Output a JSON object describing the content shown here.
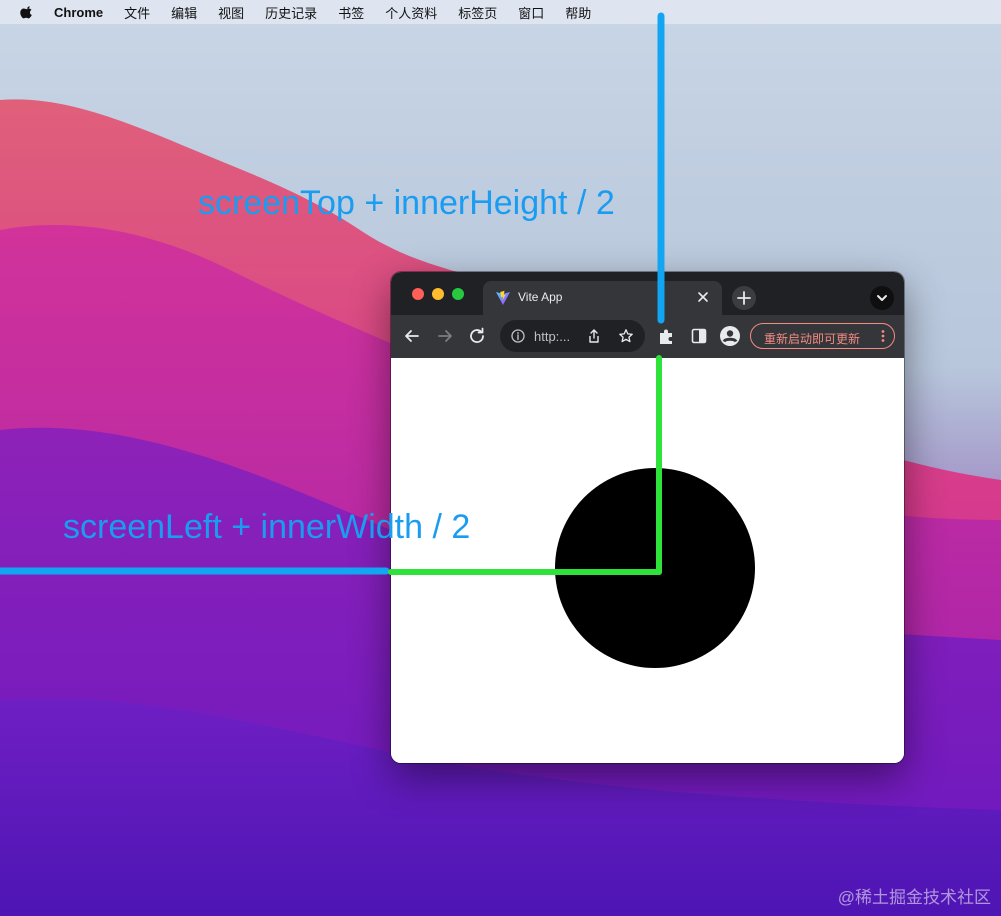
{
  "menubar": {
    "app_name": "Chrome",
    "items": [
      "文件",
      "编辑",
      "视图",
      "历史记录",
      "书签",
      "个人资料",
      "标签页",
      "窗口",
      "帮助"
    ]
  },
  "browser": {
    "tab_title": "Vite App",
    "url_text": "http:...",
    "update_button": "重新启动即可更新"
  },
  "annotations": {
    "vertical_label": "screenTop + innerHeight / 2",
    "horizontal_label": "screenLeft + innerWidth / 2",
    "line_color": "#1a9cf0",
    "inner_line_color": "#2ee23a"
  },
  "watermark": "@稀土掘金技术社区",
  "colors": {
    "circle": "#000000",
    "update_accent": "#f28b82",
    "chrome_dark": "#202124"
  }
}
